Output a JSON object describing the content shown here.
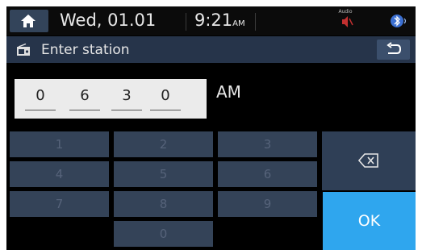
{
  "status_bar": {
    "date": "Wed, 01.01",
    "time": "9:21",
    "time_suffix": "AM",
    "audio_label": "Audio",
    "home_icon": "home-icon",
    "bluetooth_icon": "bluetooth-icon"
  },
  "title_bar": {
    "title": "Enter station",
    "radio_icon": "radio-icon",
    "back_icon": "back-arrow-icon"
  },
  "frequency": {
    "digits": [
      "0",
      "6",
      "3",
      "0"
    ],
    "band": "AM"
  },
  "keypad": {
    "keys": [
      "1",
      "2",
      "3",
      "4",
      "5",
      "6",
      "7",
      "8",
      "9",
      "0"
    ],
    "backspace_icon": "backspace-icon",
    "ok_label": "OK"
  },
  "colors": {
    "background": "#000000",
    "title_bar": "#26344a",
    "key": "#344358",
    "ok": "#2fa6ee"
  }
}
